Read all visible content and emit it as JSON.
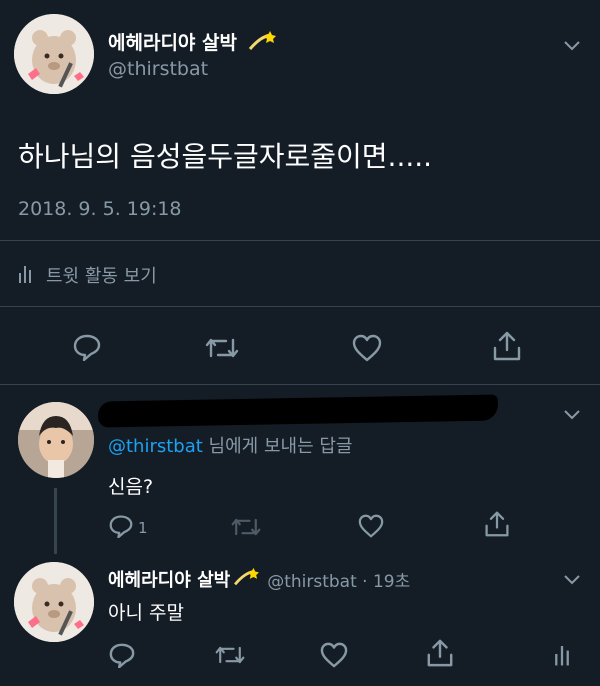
{
  "main_tweet": {
    "display_name": "에헤라디야 살박",
    "handle": "@thirstbat",
    "text": "하나님의 음성을두글자로줄이면.....",
    "timestamp": "2018. 9. 5. 19:18",
    "activity_label": "트윗 활동 보기"
  },
  "reply": {
    "replying_to_handle": "@thirstbat",
    "replying_to_suffix": " 님에게 보내는 답글",
    "text": "신음?",
    "reply_count": "1"
  },
  "second_reply": {
    "display_name": "에헤라디야 살박",
    "handle_time": "@thirstbat · 19초",
    "text": "아니 주말"
  },
  "colors": {
    "background": "#141d26",
    "divider": "#38444d",
    "muted": "#8899a6",
    "link": "#1da1f2"
  }
}
